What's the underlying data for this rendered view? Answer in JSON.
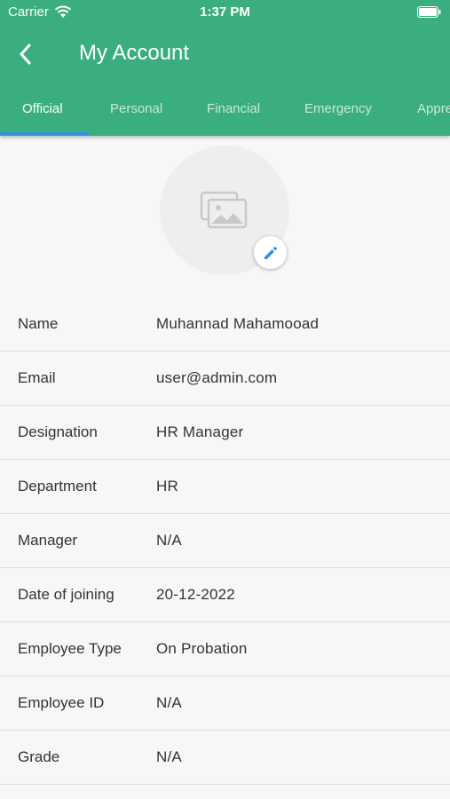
{
  "status_bar": {
    "carrier": "Carrier",
    "time": "1:37 PM"
  },
  "header": {
    "title": "My Account",
    "back_icon": "chevron-left-icon"
  },
  "tabs": [
    {
      "label": "Official",
      "active": true
    },
    {
      "label": "Personal",
      "active": false
    },
    {
      "label": "Financial",
      "active": false
    },
    {
      "label": "Emergency",
      "active": false
    },
    {
      "label": "Appre",
      "active": false
    }
  ],
  "avatar": {
    "placeholder_icon": "image-placeholder-icon",
    "edit_icon": "pencil-icon"
  },
  "details": [
    {
      "label": "Name",
      "value": "Muhannad Mahamooad"
    },
    {
      "label": "Email",
      "value": "user@admin.com"
    },
    {
      "label": "Designation",
      "value": "HR Manager"
    },
    {
      "label": "Department",
      "value": "HR"
    },
    {
      "label": "Manager",
      "value": "N/A"
    },
    {
      "label": "Date of joining",
      "value": "20-12-2022"
    },
    {
      "label": "Employee Type",
      "value": "On Probation"
    },
    {
      "label": "Employee ID",
      "value": "N/A"
    },
    {
      "label": "Grade",
      "value": "N/A"
    }
  ],
  "colors": {
    "header": "#3aae7f",
    "tab_indicator": "#2f8fe0",
    "edit_icon": "#2f8fe0",
    "background": "#f7f7f7"
  }
}
